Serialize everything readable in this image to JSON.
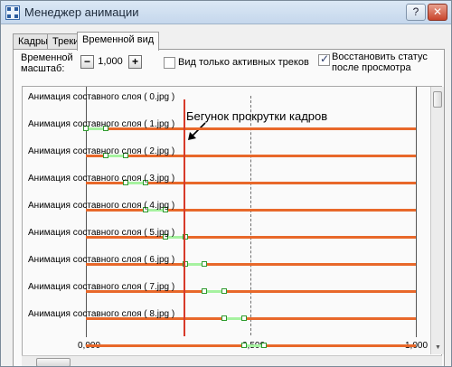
{
  "window": {
    "title": "Менеджер анимации",
    "help_label": "?",
    "close_label": "✕"
  },
  "tabs": [
    {
      "label": "Кадры",
      "active": false
    },
    {
      "label": "Треки",
      "active": false
    },
    {
      "label": "Временной вид",
      "active": true
    }
  ],
  "controls": {
    "time_scale_label": "Временной масштаб:",
    "time_scale_value": "1,000",
    "minus_label": "−",
    "plus_label": "+",
    "active_tracks_only_label": "Вид только активных треков",
    "active_tracks_only_checked": false,
    "restore_status_label": "Восстановить статус после просмотра",
    "restore_status_checked": true
  },
  "timeline": {
    "annotation": "Бегунок прокрутки кадров",
    "axis_labels": [
      "0,000",
      "0,500",
      "1,000"
    ],
    "playhead_position": 0.295,
    "tracks": [
      {
        "name": "Анимация составного слоя ( 0.jpg )",
        "start": 0.0,
        "end": 0.06
      },
      {
        "name": "Анимация составного слоя ( 1.jpg )",
        "start": 0.06,
        "end": 0.12
      },
      {
        "name": "Анимация составного слоя ( 2.jpg )",
        "start": 0.12,
        "end": 0.18
      },
      {
        "name": "Анимация составного слоя ( 3.jpg )",
        "start": 0.18,
        "end": 0.24
      },
      {
        "name": "Анимация составного слоя ( 4.jpg )",
        "start": 0.24,
        "end": 0.3
      },
      {
        "name": "Анимация составного слоя ( 5.jpg )",
        "start": 0.3,
        "end": 0.36
      },
      {
        "name": "Анимация составного слоя ( 6.jpg )",
        "start": 0.36,
        "end": 0.42
      },
      {
        "name": "Анимация составного слоя ( 7.jpg )",
        "start": 0.42,
        "end": 0.48
      },
      {
        "name": "Анимация составного слоя ( 8.jpg )",
        "start": 0.48,
        "end": 0.54
      }
    ]
  },
  "colors": {
    "track_line": "#e8682a",
    "keyframe_segment": "#a6f2a0",
    "keyframe_border": "#2e9a2e",
    "playhead": "#d73a2a"
  }
}
